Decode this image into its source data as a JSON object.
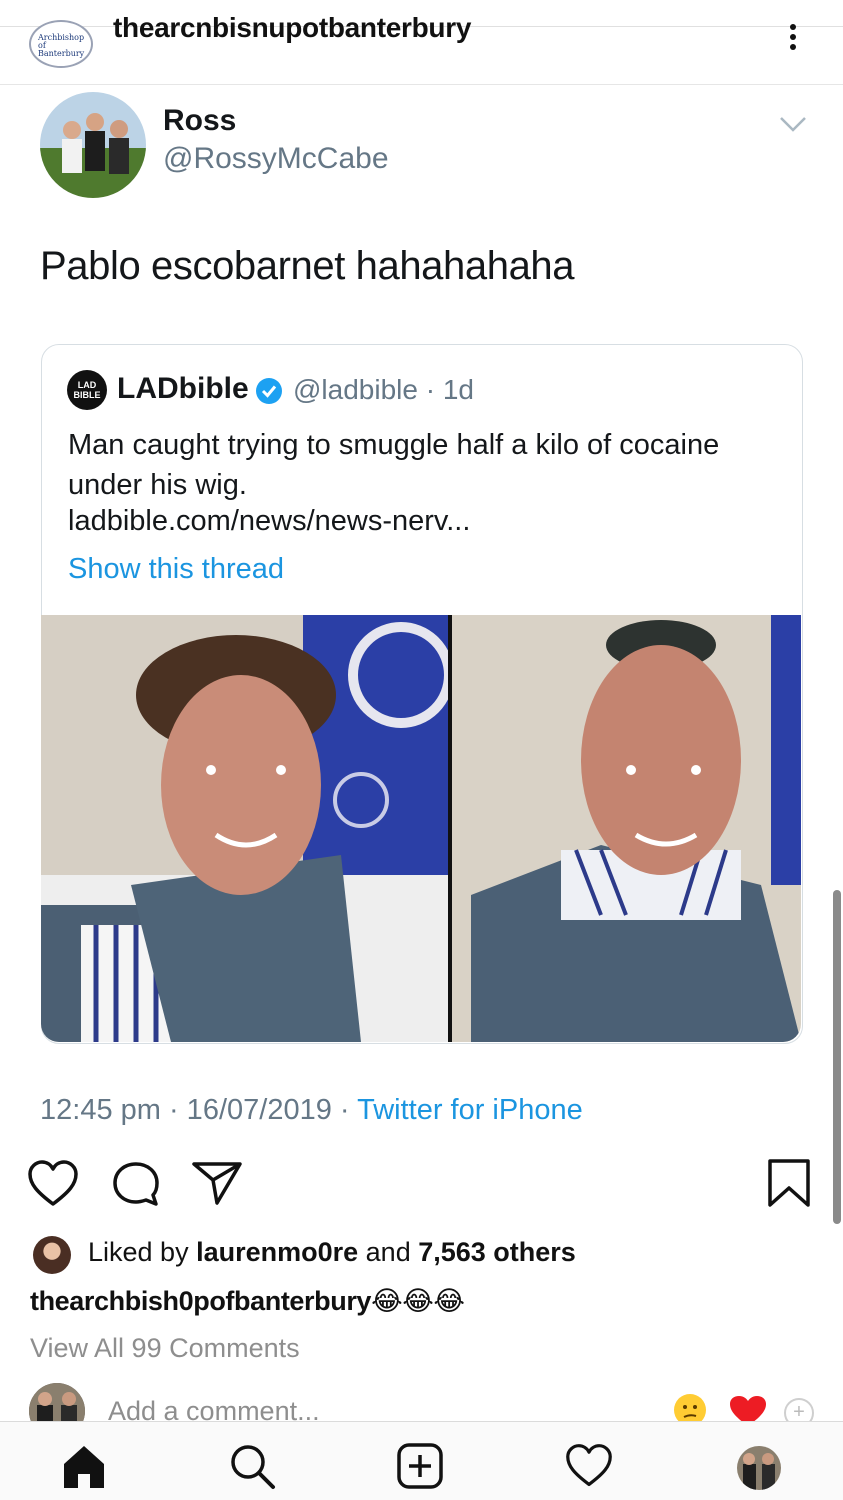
{
  "post_header": {
    "username": "thearcnbisnupotbanterbury",
    "avatar_text": "Archbishop of Banterbury"
  },
  "tweet": {
    "name": "Ross",
    "handle": "@RossyMcCabe",
    "text": "Pablo escobarnet hahahahaha",
    "quoted": {
      "logo_text": "LAD BIBLE",
      "name": "LADbible",
      "handle": "@ladbible · 1d",
      "text": "Man caught trying to smuggle half a kilo of cocaine under his wig.",
      "link": "ladbible.com/news/news-nerv...",
      "thread_label": "Show this thread"
    },
    "timestamp": "12:45 pm · 16/07/2019 · ",
    "source": "Twitter for iPhone"
  },
  "actions": {
    "liked_by_prefix": "Liked by ",
    "liked_by_user": "laurenmo0re",
    "liked_by_suffix": " and ",
    "liked_by_others": "7,563 others",
    "caption_user": "thearchbish0pofbanterbury",
    "caption_emoji": "😂😂😂",
    "view_comments": "View All 99 Comments",
    "comment_placeholder": "Add a comment..."
  },
  "colors": {
    "link_blue": "#1b95e0",
    "muted_gray": "#657786",
    "heart_red": "#ed1c24"
  },
  "icons": {
    "like": "heart-icon",
    "comment": "comment-bubble-icon",
    "share": "paper-plane-icon",
    "save": "bookmark-icon",
    "nav_home": "home-icon",
    "nav_search": "search-icon",
    "nav_add": "add-post-icon",
    "nav_activity": "heart-outline-icon",
    "nav_profile": "profile-avatar-icon"
  }
}
